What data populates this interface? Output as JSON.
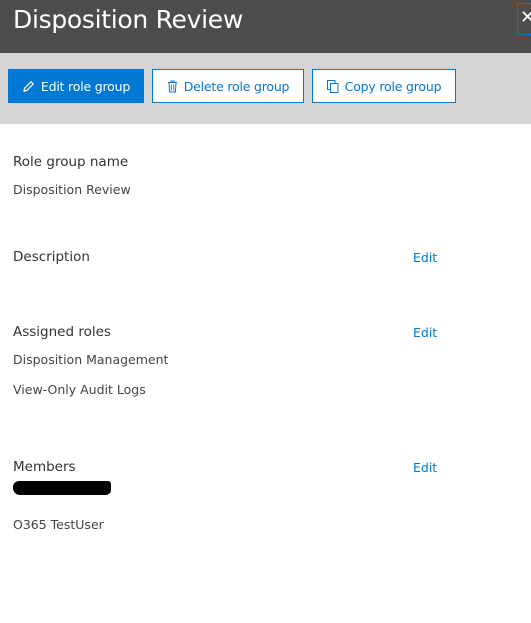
{
  "header": {
    "title": "Disposition Review",
    "close_glyph": "✕"
  },
  "toolbar": {
    "edit_label": "Edit role group",
    "delete_label": "Delete role group",
    "copy_label": "Copy role group"
  },
  "details": {
    "name_label": "Role group name",
    "name_value": "Disposition Review",
    "description_label": "Description",
    "description_edit": "Edit",
    "roles_label": "Assigned roles",
    "roles_edit": "Edit",
    "roles": [
      "Disposition Management",
      "View-Only Audit Logs"
    ],
    "members_label": "Members",
    "members_edit": "Edit",
    "members": [
      "O365 TestUser"
    ]
  },
  "colors": {
    "accent": "#0078d4",
    "header_bg": "#4d4d4d",
    "toolbar_bg": "#d4d4d4"
  }
}
